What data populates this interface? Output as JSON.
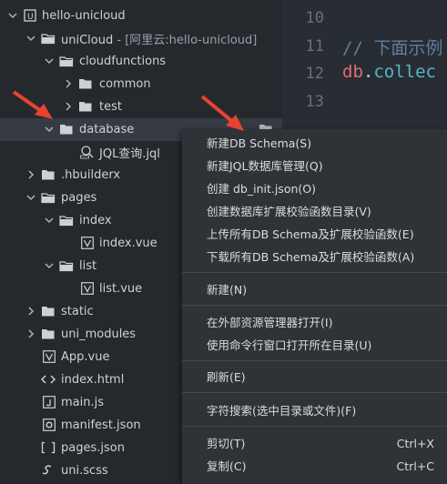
{
  "tree": {
    "project": "hello-unicloud",
    "unicloud_name": "uniCloud",
    "unicloud_suffix": " - [阿里云:hello-unicloud]",
    "cloudfunctions": "cloudfunctions",
    "common": "common",
    "test": "test",
    "database": "database",
    "jql_file": "JQL查询.jql",
    "hbuilderx": ".hbuilderx",
    "pages": "pages",
    "index_folder": "index",
    "index_vue": "index.vue",
    "list_folder": "list",
    "list_vue": "list.vue",
    "static": "static",
    "uni_modules": "uni_modules",
    "app_vue": "App.vue",
    "index_html": "index.html",
    "main_js": "main.js",
    "manifest_json": "manifest.json",
    "pages_json": "pages.json",
    "uni_scss": "uni.scss"
  },
  "editor": {
    "line_numbers": [
      "10",
      "11",
      "12",
      "13"
    ],
    "comment": "// 下面示例",
    "code_db": "db",
    "code_dot": ".",
    "code_fn": "collec"
  },
  "menu": {
    "new_schema": "新建DB Schema(S)",
    "new_jql": "新建JQL数据库管理(Q)",
    "create_init": "创建 db_init.json(O)",
    "create_validate_dir": "创建数据库扩展校验函数目录(V)",
    "upload_all": "上传所有DB Schema及扩展校验函数(E)",
    "download_all": "下载所有DB Schema及扩展校验函数(A)",
    "new": "新建(N)",
    "open_in_explorer": "在外部资源管理器打开(I)",
    "open_in_terminal": "使用命令行窗口打开所在目录(U)",
    "refresh": "刷新(E)",
    "search": "字符搜索(选中目录或文件)(F)",
    "cut": "剪切(T)",
    "cut_shortcut": "Ctrl+X",
    "copy": "复制(C)",
    "copy_shortcut": "Ctrl+C"
  },
  "colors": {
    "background": "#25292e",
    "selected_row": "#363b43",
    "menu_bg": "#2f3338",
    "annotation_arrow": "#e8432f"
  }
}
